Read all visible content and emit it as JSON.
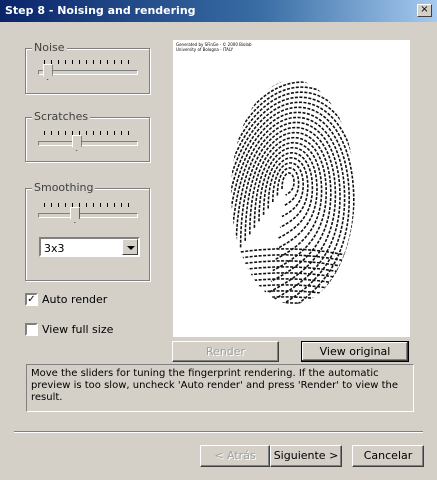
{
  "window": {
    "title": "Step 8 - Noising and rendering",
    "close_label": "×"
  },
  "noise": {
    "label": "Noise",
    "slider_fraction": 0.04
  },
  "scratches": {
    "label": "Scratches",
    "slider_fraction": 0.37
  },
  "smoothing": {
    "label": "Smoothing",
    "slider_fraction": 0.35,
    "kernel_value": "3x3"
  },
  "options": {
    "auto_render_label": "Auto render",
    "auto_render_checked": true,
    "auto_render_mark": "✓",
    "view_full_size_label": "View full size",
    "view_full_size_checked": false
  },
  "preview": {
    "credits_line1": "Generated by SFinGe - © 2000 Biolab",
    "credits_line2": "University of Bologna - ITALY"
  },
  "buttons": {
    "render_label": "Render",
    "view_original_label": "View original",
    "back_label": "< Atrás",
    "next_label": "Siguiente >",
    "cancel_label": "Cancelar"
  },
  "info_text": "Move the sliders for tuning the fingerprint rendering. If the automatic preview is too slow, uncheck 'Auto render' and press 'Render' to view the result."
}
